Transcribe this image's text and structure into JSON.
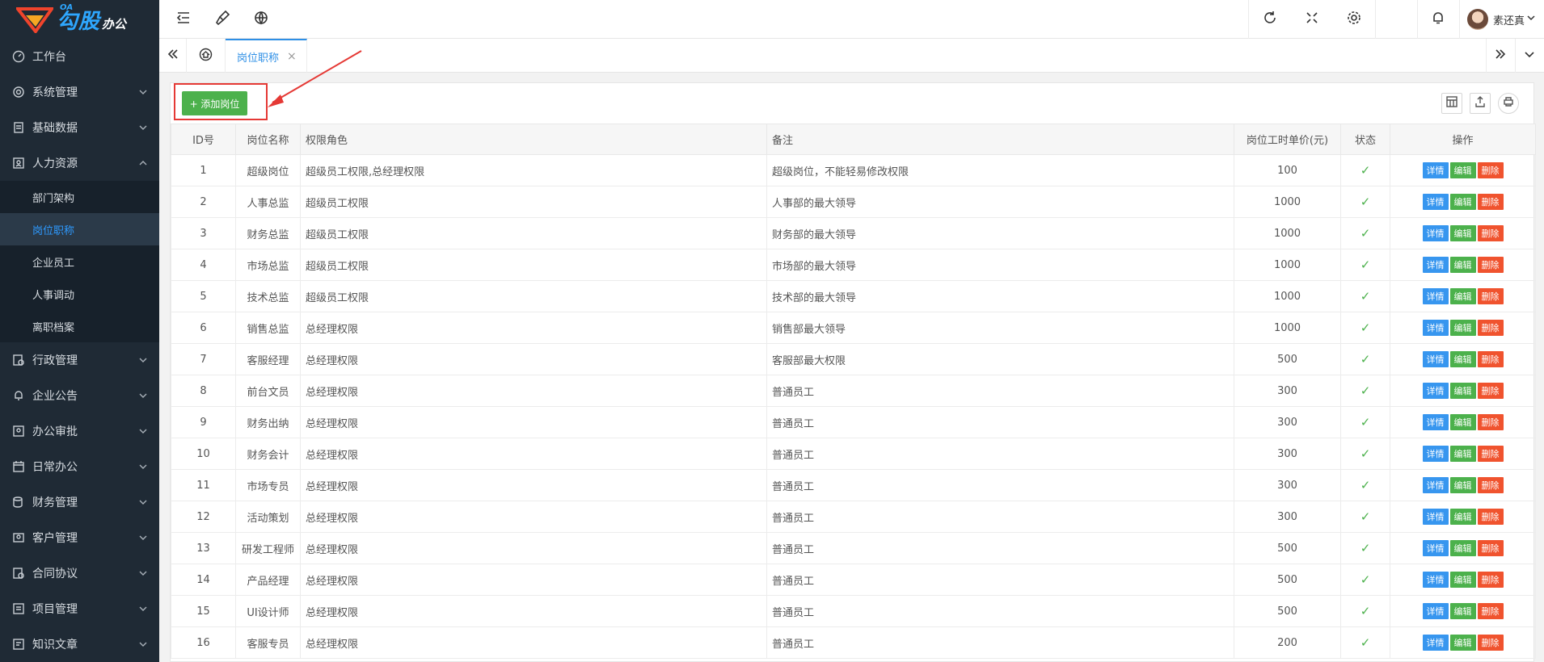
{
  "logo": {
    "top_text": "OA",
    "main_text": "勾股",
    "sub_text": "办公"
  },
  "sidebar": {
    "items": [
      {
        "label": "工作台",
        "icon": "dashboard-icon"
      },
      {
        "label": "系统管理",
        "icon": "gear-icon"
      },
      {
        "label": "基础数据",
        "icon": "database-icon"
      },
      {
        "label": "人力资源",
        "icon": "user-square-icon",
        "expanded": true,
        "children": [
          {
            "label": "部门架构"
          },
          {
            "label": "岗位职称",
            "active": true
          },
          {
            "label": "企业员工"
          },
          {
            "label": "人事调动"
          },
          {
            "label": "离职档案"
          }
        ]
      },
      {
        "label": "行政管理",
        "icon": "admin-icon"
      },
      {
        "label": "企业公告",
        "icon": "bell-icon"
      },
      {
        "label": "办公审批",
        "icon": "approval-icon"
      },
      {
        "label": "日常办公",
        "icon": "calendar-icon"
      },
      {
        "label": "财务管理",
        "icon": "finance-icon"
      },
      {
        "label": "客户管理",
        "icon": "customer-icon"
      },
      {
        "label": "合同协议",
        "icon": "contract-icon"
      },
      {
        "label": "项目管理",
        "icon": "project-icon"
      },
      {
        "label": "知识文章",
        "icon": "article-icon"
      }
    ]
  },
  "header": {
    "user_name": "素还真"
  },
  "tabs": {
    "active_label": "岗位职称",
    "close_glyph": "×"
  },
  "toolbar": {
    "add_label": "+ 添加岗位"
  },
  "table": {
    "columns": [
      "ID号",
      "岗位名称",
      "权限角色",
      "备注",
      "岗位工时单价(元)",
      "状态",
      "操作"
    ],
    "actions": {
      "detail": "详情",
      "edit": "编辑",
      "delete": "删除"
    },
    "status_glyph": "✓",
    "rows": [
      {
        "id": "1",
        "name": "超级岗位",
        "role": "超级员工权限,总经理权限",
        "remark": "超级岗位，不能轻易修改权限",
        "price": "100"
      },
      {
        "id": "2",
        "name": "人事总监",
        "role": "超级员工权限",
        "remark": "人事部的最大领导",
        "price": "1000"
      },
      {
        "id": "3",
        "name": "财务总监",
        "role": "超级员工权限",
        "remark": "财务部的最大领导",
        "price": "1000"
      },
      {
        "id": "4",
        "name": "市场总监",
        "role": "超级员工权限",
        "remark": "市场部的最大领导",
        "price": "1000"
      },
      {
        "id": "5",
        "name": "技术总监",
        "role": "超级员工权限",
        "remark": "技术部的最大领导",
        "price": "1000"
      },
      {
        "id": "6",
        "name": "销售总监",
        "role": "总经理权限",
        "remark": "销售部最大领导",
        "price": "1000"
      },
      {
        "id": "7",
        "name": "客服经理",
        "role": "总经理权限",
        "remark": "客服部最大权限",
        "price": "500"
      },
      {
        "id": "8",
        "name": "前台文员",
        "role": "总经理权限",
        "remark": "普通员工",
        "price": "300"
      },
      {
        "id": "9",
        "name": "财务出纳",
        "role": "总经理权限",
        "remark": "普通员工",
        "price": "300"
      },
      {
        "id": "10",
        "name": "财务会计",
        "role": "总经理权限",
        "remark": "普通员工",
        "price": "300"
      },
      {
        "id": "11",
        "name": "市场专员",
        "role": "总经理权限",
        "remark": "普通员工",
        "price": "300"
      },
      {
        "id": "12",
        "name": "活动策划",
        "role": "总经理权限",
        "remark": "普通员工",
        "price": "300"
      },
      {
        "id": "13",
        "name": "研发工程师",
        "role": "总经理权限",
        "remark": "普通员工",
        "price": "500"
      },
      {
        "id": "14",
        "name": "产品经理",
        "role": "总经理权限",
        "remark": "普通员工",
        "price": "500"
      },
      {
        "id": "15",
        "name": "UI设计师",
        "role": "总经理权限",
        "remark": "普通员工",
        "price": "500"
      },
      {
        "id": "16",
        "name": "客服专员",
        "role": "总经理权限",
        "remark": "普通员工",
        "price": "200"
      }
    ]
  }
}
